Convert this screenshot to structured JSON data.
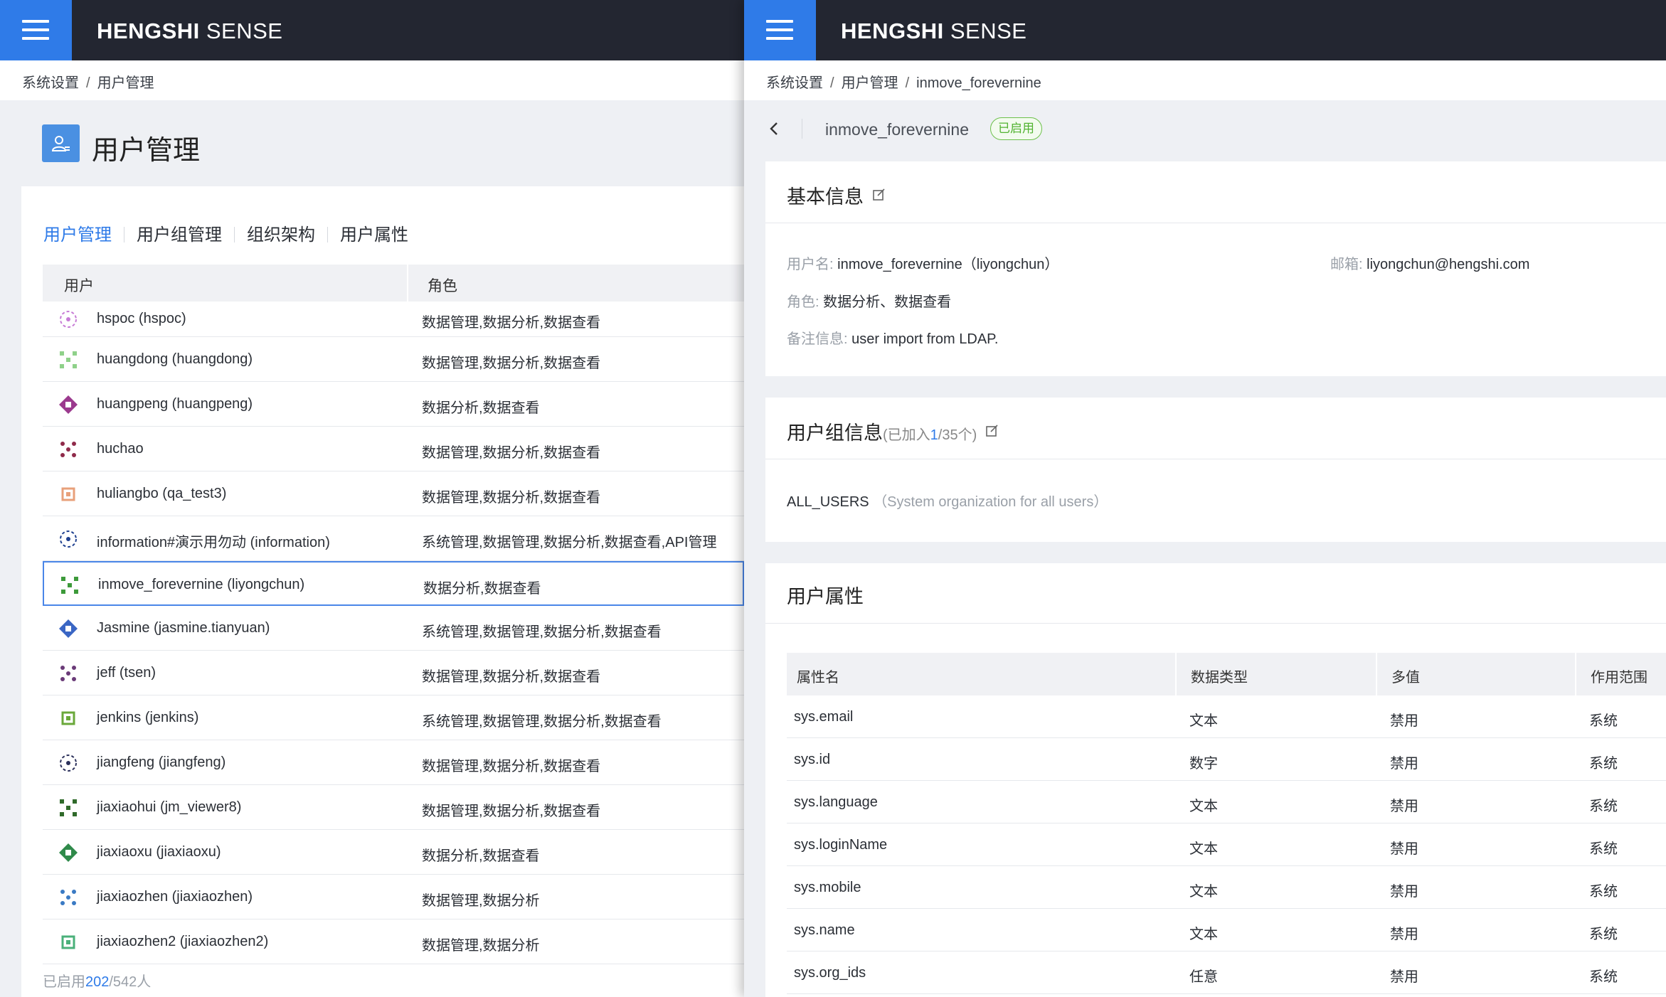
{
  "app": {
    "brand_bold": "HENGSHI",
    "brand_light": "SENSE"
  },
  "left": {
    "breadcrumb": [
      "系统设置",
      "用户管理"
    ],
    "page_title": "用户管理",
    "tabs": [
      {
        "label": "用户管理",
        "active": true
      },
      {
        "label": "用户组管理",
        "active": false
      },
      {
        "label": "组织架构",
        "active": false
      },
      {
        "label": "用户属性",
        "active": false
      }
    ],
    "table_headers": {
      "user": "用户",
      "role": "角色"
    },
    "users": [
      {
        "name": "hspoc (hspoc)",
        "roles": "数据管理,数据分析,数据查看",
        "color": "#c77bd6"
      },
      {
        "name": "huangdong (huangdong)",
        "roles": "数据管理,数据分析,数据查看",
        "color": "#8fd18a"
      },
      {
        "name": "huangpeng (huangpeng)",
        "roles": "数据分析,数据查看",
        "color": "#9b3a8e"
      },
      {
        "name": "huchao",
        "roles": "数据管理,数据分析,数据查看",
        "color": "#8f2a4a"
      },
      {
        "name": "huliangbo (qa_test3)",
        "roles": "数据管理,数据分析,数据查看",
        "color": "#e8a07a"
      },
      {
        "name": "information#演示用勿动 (information)",
        "roles": "系统管理,数据管理,数据分析,数据查看,API管理",
        "color": "#1d3f8f"
      },
      {
        "name": "inmove_forevernine (liyongchun)",
        "roles": "数据分析,数据查看",
        "color": "#3d9a3a"
      },
      {
        "name": "Jasmine (jasmine.tianyuan)",
        "roles": "系统管理,数据管理,数据分析,数据查看",
        "color": "#3a66c4"
      },
      {
        "name": "jeff (tsen)",
        "roles": "数据管理,数据分析,数据查看",
        "color": "#6a3a78"
      },
      {
        "name": "jenkins (jenkins)",
        "roles": "系统管理,数据管理,数据分析,数据查看",
        "color": "#6aa83a"
      },
      {
        "name": "jiangfeng (jiangfeng)",
        "roles": "数据管理,数据分析,数据查看",
        "color": "#2a2f5a"
      },
      {
        "name": "jiaxiaohui (jm_viewer8)",
        "roles": "数据管理,数据分析,数据查看",
        "color": "#2f6a2a"
      },
      {
        "name": "jiaxiaoxu (jiaxiaoxu)",
        "roles": "数据分析,数据查看",
        "color": "#2f8a4a"
      },
      {
        "name": "jiaxiaozhen (jiaxiaozhen)",
        "roles": "数据管理,数据分析",
        "color": "#3a7ac4"
      },
      {
        "name": "jiaxiaozhen2 (jiaxiaozhen2)",
        "roles": "数据管理,数据分析",
        "color": "#4ab07a"
      }
    ],
    "selected_index": 6,
    "footer": {
      "prefix": "已启用",
      "enabled": "202",
      "suffix": "/542人"
    }
  },
  "right": {
    "breadcrumb": [
      "系统设置",
      "用户管理",
      "inmove_forevernine"
    ],
    "detail_name": "inmove_forevernine",
    "status": "已启用",
    "basic": {
      "title": "基本信息",
      "username_label": "用户名:",
      "username_value": "inmove_forevernine（liyongchun）",
      "email_label": "邮箱:",
      "email_value": "liyongchun@hengshi.com",
      "role_label": "角色:",
      "role_value": "数据分析、数据查看",
      "note_label": "备注信息:",
      "note_value": "user import from LDAP."
    },
    "groups": {
      "title": "用户组信息",
      "sub_prefix": "(已加入",
      "joined": "1",
      "sub_suffix": "/35个)",
      "group_name": "ALL_USERS",
      "group_desc": "（System organization for all users）"
    },
    "attributes": {
      "title": "用户属性",
      "headers": [
        "属性名",
        "数据类型",
        "多值",
        "作用范围"
      ],
      "rows": [
        [
          "sys.email",
          "文本",
          "禁用",
          "系统"
        ],
        [
          "sys.id",
          "数字",
          "禁用",
          "系统"
        ],
        [
          "sys.language",
          "文本",
          "禁用",
          "系统"
        ],
        [
          "sys.loginName",
          "文本",
          "禁用",
          "系统"
        ],
        [
          "sys.mobile",
          "文本",
          "禁用",
          "系统"
        ],
        [
          "sys.name",
          "文本",
          "禁用",
          "系统"
        ],
        [
          "sys.org_ids",
          "任意",
          "禁用",
          "系统"
        ]
      ]
    }
  }
}
